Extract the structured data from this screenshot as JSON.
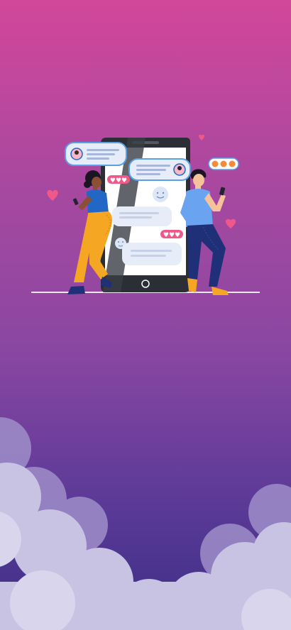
{
  "screen": {
    "colors": {
      "background_top": "#d2479a",
      "background_bottom": "#3b2e86",
      "phone_frame": "#2b2e35",
      "phone_screen": "#ffffff",
      "bubble": "#e6ecf8",
      "bubble_border": "#5aa0e6",
      "heart": "#f0588a",
      "woman_top": "#2266c6",
      "woman_pants": "#f5a623",
      "man_shirt": "#6aa3f0",
      "man_pants": "#1f2f78",
      "clouds": "#c8c3e3"
    },
    "icons": [
      "heart-icon",
      "emoji-icon",
      "phone-home-button-icon"
    ]
  }
}
